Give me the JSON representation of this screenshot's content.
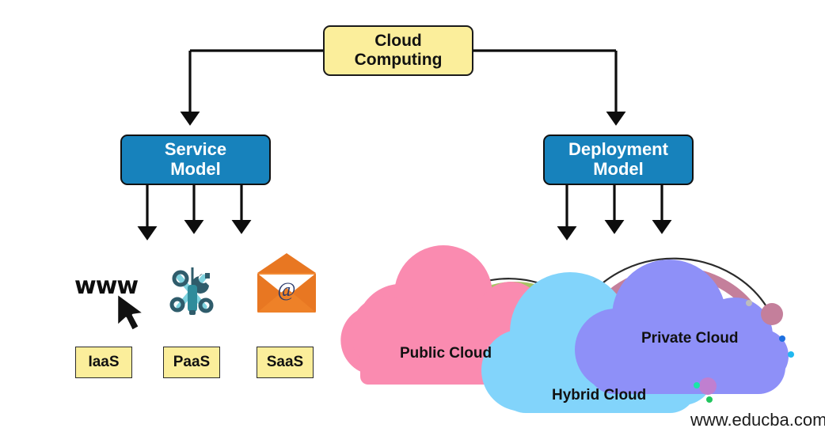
{
  "diagram": {
    "title": "Cloud Computing types hierarchy",
    "watermark": "www.educba.com",
    "colors": {
      "root_fill": "#FBEE9B",
      "branch_fill": "#1782BC",
      "leaf_fill": "#FBEE9B",
      "stroke": "#111111",
      "public_cloud": "#FA8BB0",
      "hybrid_cloud": "#82D4FB",
      "private_cloud": "#8E90F8",
      "arc_green": "#A8C264",
      "arc_magenta": "#EE22C4",
      "arc_mauve": "#C47F9B",
      "arc_cyan": "#20B8F0",
      "arc_black": "#2b2b2b",
      "mail_orange": "#E87722",
      "tool_teal": "#2F8C9B"
    }
  },
  "nodes": {
    "root": {
      "label": "Cloud\nComputing"
    },
    "service_model": {
      "label": "Service\nModel"
    },
    "deployment_model": {
      "label": "Deployment\nModel"
    }
  },
  "service_leaves": [
    {
      "label": "IaaS",
      "icon": "www-icon",
      "icon_text": "www"
    },
    {
      "label": "PaaS",
      "icon": "tools-icon",
      "icon_text": ""
    },
    {
      "label": "SaaS",
      "icon": "email-icon",
      "icon_text": "@"
    }
  ],
  "deployment_clouds": [
    {
      "label": "Public Cloud",
      "color": "#FA8BB0"
    },
    {
      "label": "Hybrid Cloud",
      "color": "#82D4FB"
    },
    {
      "label": "Private Cloud",
      "color": "#8E90F8"
    }
  ]
}
